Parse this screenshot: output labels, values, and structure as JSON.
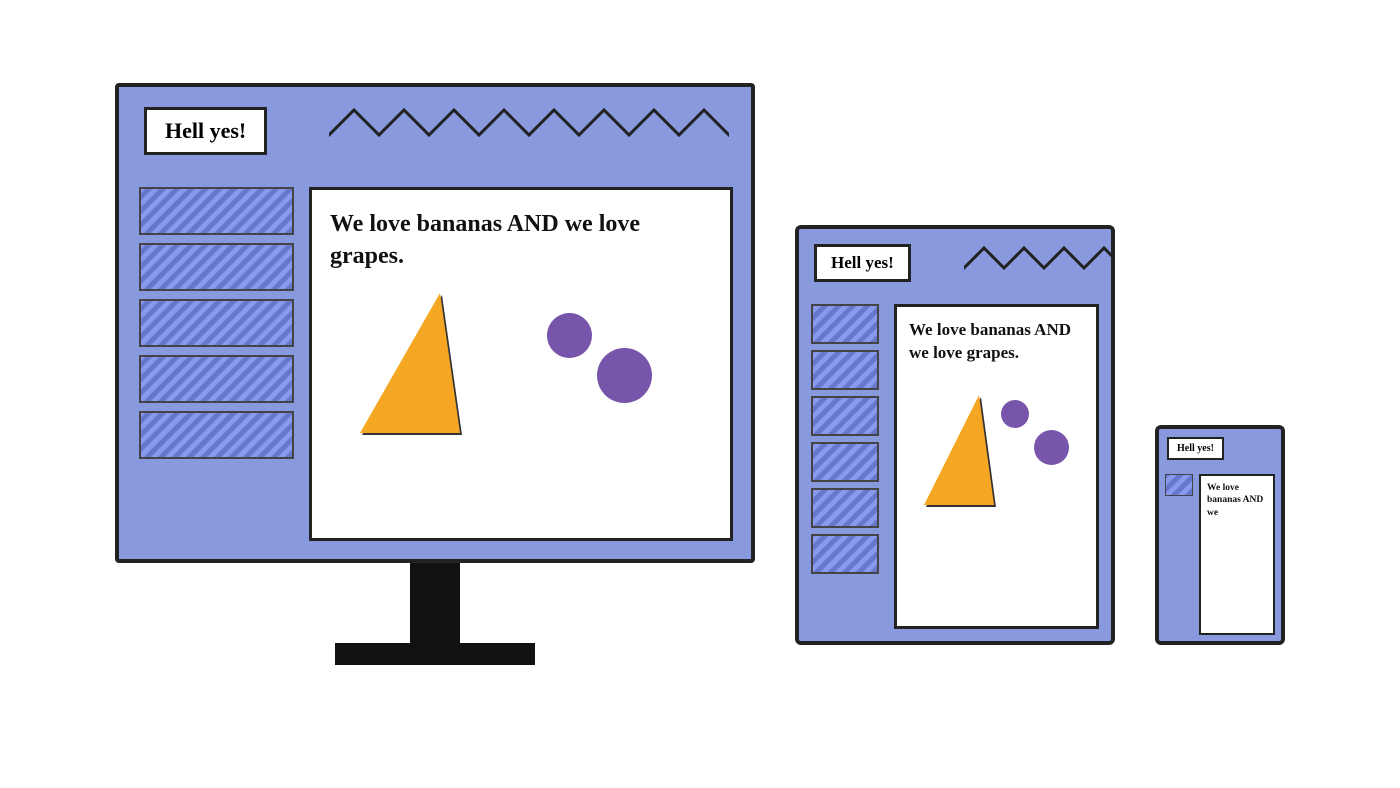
{
  "monitor": {
    "hell_yes_label": "Hell yes!",
    "content_text": "We love bananas AND we love grapes.",
    "sidebar_stripe_count": 5
  },
  "tablet": {
    "hell_yes_label": "Hell yes!",
    "content_text": "We love bananas AND we love grapes.",
    "sidebar_stripe_count": 6
  },
  "phone": {
    "hell_yes_label": "Hell yes!",
    "content_text": "We love bananas AND we",
    "sidebar_stripe_count": 1
  }
}
